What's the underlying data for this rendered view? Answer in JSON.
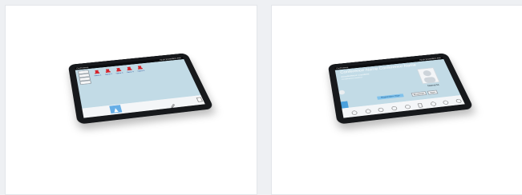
{
  "left_device": {
    "status_left": "Conference",
    "status_right": "10:25  2019/08/01  FRI",
    "menu_items": [
      "Seat",
      "Layout",
      "Class",
      "Vote"
    ],
    "seats": [
      {
        "label": "Name 1"
      },
      {
        "label": "Name 2"
      },
      {
        "label": "Name 3"
      },
      {
        "label": "Name 4"
      },
      {
        "label": "Name 5"
      }
    ],
    "bottom_icon": "pen-icon",
    "colors": {
      "screen": "#c2dbe6",
      "seat": "#d5242c",
      "accent": "#66aee6",
      "frame": "#17191c"
    }
  },
  "right_device": {
    "status_left": "Conference",
    "status_right": "10:25  2019/08/01  FRI",
    "title": "Conference Name Conference Name",
    "subtitle": "Conference Content",
    "subtitle2": "Conference content",
    "person_name": "Name11",
    "registration_label": "Registration Sign",
    "control_buttons": [
      "Broadcast",
      "Start"
    ],
    "bottom_icons": [
      "user-icon",
      "notes-icon",
      "vote-icon",
      "chat-icon",
      "mic-icon",
      "document-icon",
      "pen-icon",
      "settings-icon",
      "service-icon"
    ],
    "colors": {
      "screen": "#c2dbe6",
      "accent": "#80c2ec",
      "side": "#4aa0dc",
      "frame": "#17191c"
    }
  }
}
